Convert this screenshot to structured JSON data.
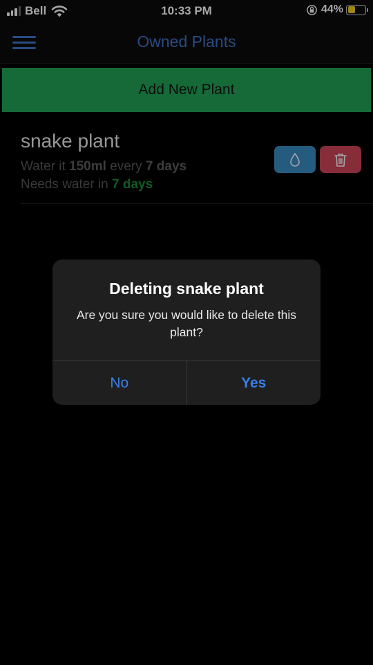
{
  "status_bar": {
    "carrier": "Bell",
    "time": "10:33 PM",
    "battery": "44%",
    "battery_level": 0.44,
    "icons": [
      "signal-icon",
      "wifi-icon",
      "rotation-lock-icon",
      "battery-icon"
    ]
  },
  "header": {
    "title": "Owned Plants",
    "menu_icon": "hamburger-menu-icon"
  },
  "add_button_label": "Add New Plant",
  "plants": [
    {
      "name": "snake plant",
      "water_prefix": "Water it",
      "amount": "150ml",
      "every_label": "every",
      "interval": "7 days",
      "needs_prefix": "Needs water in",
      "due": "7 days",
      "water_icon": "water-drop-icon",
      "delete_icon": "trash-icon"
    }
  ],
  "dialog": {
    "title": "Deleting snake plant",
    "message": "Are you sure you would like to delete this plant?",
    "no_label": "No",
    "yes_label": "Yes"
  },
  "colors": {
    "accent_blue": "#3f74cb",
    "add_green": "#21a456",
    "water_button": "#3a8dc2",
    "delete_button": "#cf4458",
    "due_green": "#1a8a3a",
    "dialog_button": "#3a7fe8"
  }
}
